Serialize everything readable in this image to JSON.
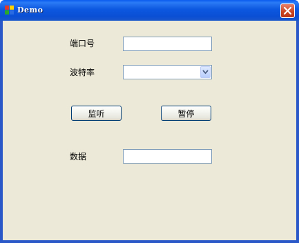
{
  "window": {
    "title": "Demo",
    "close_label": ""
  },
  "form": {
    "port_label": "端口号",
    "port_value": "",
    "baud_label": "波特率",
    "baud_value": "",
    "listen_button": "监听",
    "pause_button": "暂停",
    "data_label": "数据",
    "data_value": ""
  },
  "icons": {
    "app": "app-icon",
    "close": "close-icon",
    "dropdown": "chevron-down-icon"
  },
  "colors": {
    "titlebar": "#0a5cf0",
    "client_background": "#ece9d8",
    "close_button": "#c8441f",
    "input_border": "#7f9db9",
    "button_border": "#003c74"
  }
}
